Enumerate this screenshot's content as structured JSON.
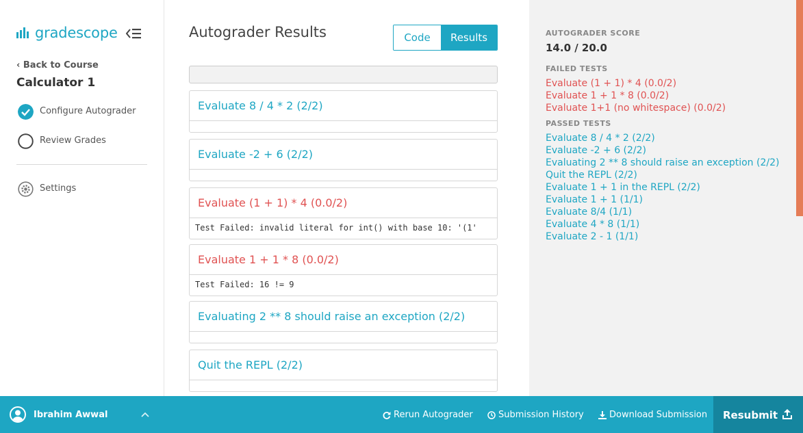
{
  "brand": {
    "name": "gradescope",
    "color": "#1ea6c3"
  },
  "sidebar": {
    "back_label": "Back to Course",
    "course_title": "Calculator 1",
    "items": [
      {
        "label": "Configure Autograder",
        "icon": "check-circle-icon",
        "state": "complete"
      },
      {
        "label": "Review Grades",
        "icon": "empty-circle-icon",
        "state": "incomplete"
      },
      {
        "label": "Settings",
        "icon": "gear-icon"
      }
    ]
  },
  "main": {
    "title": "Autograder Results",
    "toggle": {
      "code_label": "Code",
      "results_label": "Results",
      "selected": "Results"
    },
    "tests": [
      {
        "title": "Evaluate 8 / 4 * 2 (2/2)",
        "status": "pass",
        "output": ""
      },
      {
        "title": "Evaluate -2 + 6 (2/2)",
        "status": "pass",
        "output": ""
      },
      {
        "title": "Evaluate (1 + 1) * 4 (0.0/2)",
        "status": "fail",
        "output": "Test Failed: invalid literal for int() with base 10: '(1'"
      },
      {
        "title": "Evaluate 1 + 1 * 8 (0.0/2)",
        "status": "fail",
        "output": "Test Failed: 16 != 9"
      },
      {
        "title": "Evaluating 2 ** 8 should raise an exception (2/2)",
        "status": "pass",
        "output": ""
      },
      {
        "title": "Quit the REPL (2/2)",
        "status": "pass",
        "output": ""
      }
    ]
  },
  "summary": {
    "score_label": "AUTOGRADER SCORE",
    "score": "14.0 / 20.0",
    "failed_label": "FAILED TESTS",
    "failed": [
      "Evaluate (1 + 1) * 4 (0.0/2)",
      "Evaluate 1 + 1 * 8 (0.0/2)",
      "Evaluate 1+1 (no whitespace) (0.0/2)"
    ],
    "passed_label": "PASSED TESTS",
    "passed": [
      "Evaluate 8 / 4 * 2 (2/2)",
      "Evaluate -2 + 6 (2/2)",
      "Evaluating 2 ** 8 should raise an exception (2/2)",
      "Quit the REPL (2/2)",
      "Evaluate 1 + 1 in the REPL (2/2)",
      "Evaluate 1 + 1 (1/1)",
      "Evaluate 8/4 (1/1)",
      "Evaluate 4 * 8 (1/1)",
      "Evaluate 2 - 1 (1/1)"
    ]
  },
  "footer": {
    "user_name": "Ibrahim Awwal",
    "rerun_label": "Rerun Autograder",
    "history_label": "Submission History",
    "download_label": "Download Submission",
    "resubmit_label": "Resubmit"
  },
  "colors": {
    "accent": "#1ea6c3",
    "fail": "#e05252",
    "footer_dark": "#15859e",
    "scrollbar": "#e57d57"
  }
}
